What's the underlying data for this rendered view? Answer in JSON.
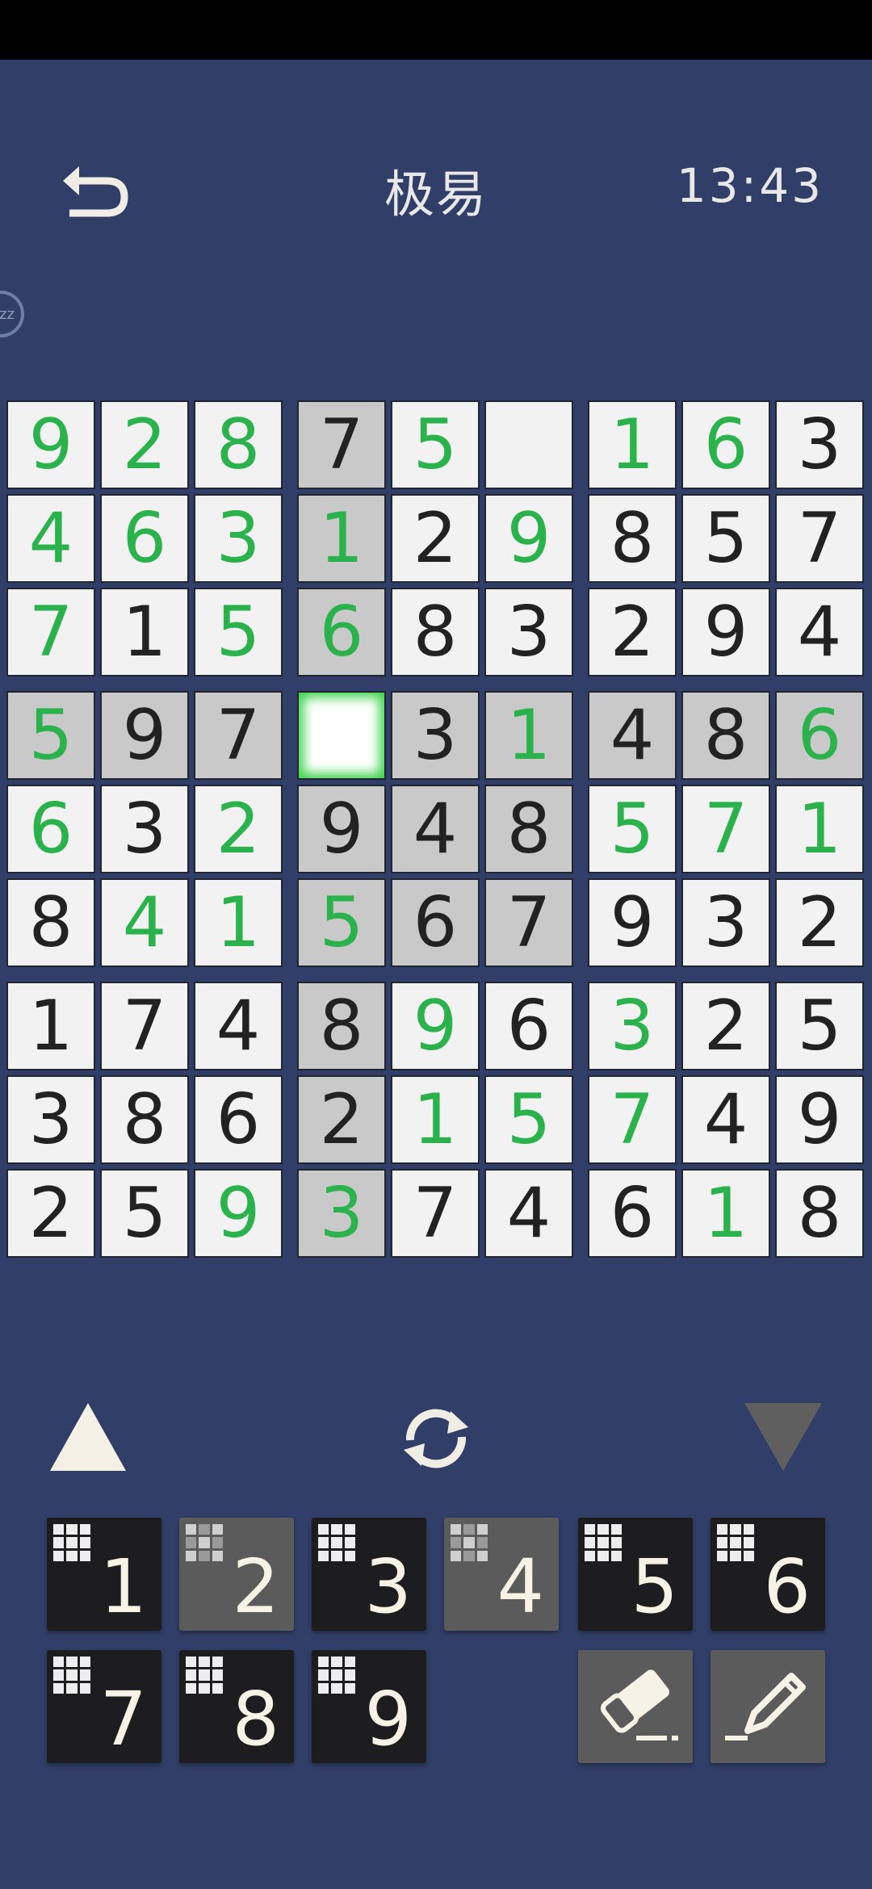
{
  "header": {
    "title": "极易",
    "timer": "13:43",
    "pause_label": "zz"
  },
  "board": {
    "values": [
      [
        "9",
        "2",
        "8",
        "7",
        "5",
        "",
        "1",
        "6",
        "3"
      ],
      [
        "4",
        "6",
        "3",
        "1",
        "2",
        "9",
        "8",
        "5",
        "7"
      ],
      [
        "7",
        "1",
        "5",
        "6",
        "8",
        "3",
        "2",
        "9",
        "4"
      ],
      [
        "5",
        "9",
        "7",
        "",
        "3",
        "1",
        "4",
        "8",
        "6"
      ],
      [
        "6",
        "3",
        "2",
        "9",
        "4",
        "8",
        "5",
        "7",
        "1"
      ],
      [
        "8",
        "4",
        "1",
        "5",
        "6",
        "7",
        "9",
        "3",
        "2"
      ],
      [
        "1",
        "7",
        "4",
        "8",
        "9",
        "6",
        "3",
        "2",
        "5"
      ],
      [
        "3",
        "8",
        "6",
        "2",
        "1",
        "5",
        "7",
        "4",
        "9"
      ],
      [
        "2",
        "5",
        "9",
        "3",
        "7",
        "4",
        "6",
        "1",
        "8"
      ]
    ],
    "green": [
      [
        1,
        1,
        1,
        0,
        1,
        0,
        1,
        1,
        0
      ],
      [
        1,
        1,
        1,
        1,
        0,
        1,
        0,
        0,
        0
      ],
      [
        1,
        0,
        1,
        1,
        0,
        0,
        0,
        0,
        0
      ],
      [
        1,
        0,
        0,
        0,
        0,
        1,
        0,
        0,
        1
      ],
      [
        1,
        0,
        1,
        0,
        0,
        0,
        1,
        1,
        1
      ],
      [
        0,
        1,
        1,
        1,
        0,
        0,
        0,
        0,
        0
      ],
      [
        0,
        0,
        0,
        0,
        1,
        0,
        1,
        0,
        0
      ],
      [
        0,
        0,
        0,
        0,
        1,
        1,
        1,
        0,
        0
      ],
      [
        0,
        0,
        1,
        1,
        0,
        0,
        0,
        1,
        0
      ]
    ],
    "highlighted": [
      [
        0,
        0,
        0,
        1,
        0,
        0,
        0,
        0,
        0
      ],
      [
        0,
        0,
        0,
        1,
        0,
        0,
        0,
        0,
        0
      ],
      [
        0,
        0,
        0,
        1,
        0,
        0,
        0,
        0,
        0
      ],
      [
        1,
        1,
        1,
        0,
        1,
        1,
        1,
        1,
        1
      ],
      [
        0,
        0,
        0,
        1,
        1,
        1,
        0,
        0,
        0
      ],
      [
        0,
        0,
        0,
        1,
        1,
        1,
        0,
        0,
        0
      ],
      [
        0,
        0,
        0,
        1,
        0,
        0,
        0,
        0,
        0
      ],
      [
        0,
        0,
        0,
        1,
        0,
        0,
        0,
        0,
        0
      ],
      [
        0,
        0,
        0,
        1,
        0,
        0,
        0,
        0,
        0
      ]
    ],
    "selected": [
      3,
      3
    ],
    "given_color": "#2bb24c",
    "text_color": "#222222"
  },
  "keypad": {
    "keys": [
      {
        "label": "1",
        "state": "dark"
      },
      {
        "label": "2",
        "state": "light"
      },
      {
        "label": "3",
        "state": "dark"
      },
      {
        "label": "4",
        "state": "light"
      },
      {
        "label": "5",
        "state": "dark"
      },
      {
        "label": "6",
        "state": "dark"
      },
      {
        "label": "7",
        "state": "dark"
      },
      {
        "label": "8",
        "state": "dark"
      },
      {
        "label": "9",
        "state": "dark"
      }
    ],
    "tools": [
      "eraser-icon",
      "pencil-icon"
    ]
  },
  "colors": {
    "background": "#313f68",
    "accent_green": "#2bb24c"
  }
}
